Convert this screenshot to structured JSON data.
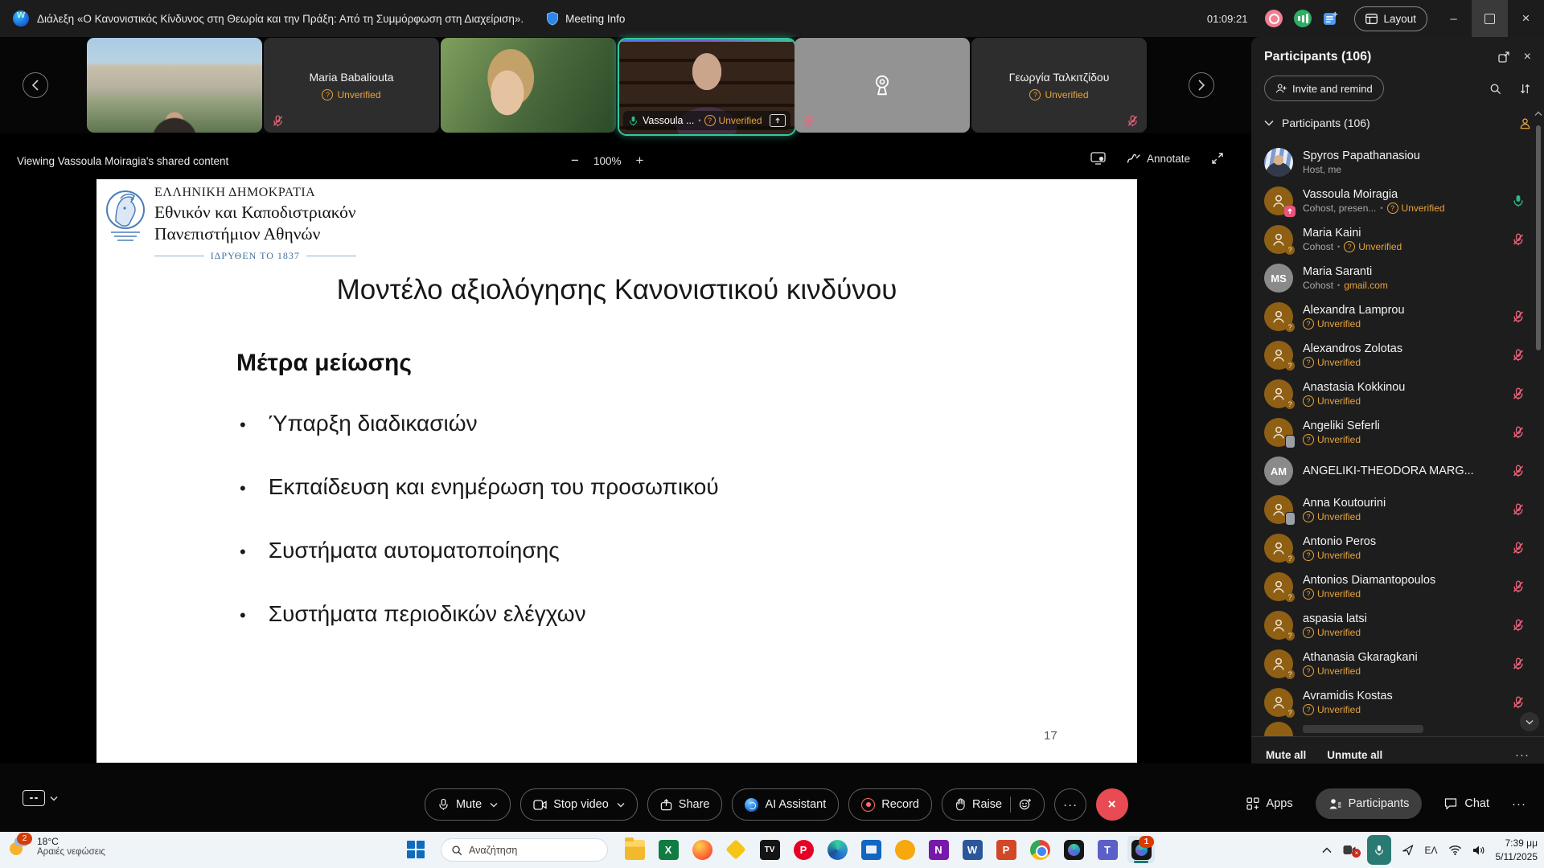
{
  "icons": {
    "more": "···",
    "minimize": "–",
    "close": "×",
    "q": "?",
    "bullet": "•",
    "leave": "×"
  },
  "titlebar": {
    "meeting_title": "Διάλεξη «Ο Κανονιστικός Κίνδυνος στη Θεωρία και την Πράξη: Από τη Συμμόρφωση στη Διαχείριση».",
    "meeting_info": "Meeting Info",
    "timer": "01:09:21",
    "layout_label": "Layout"
  },
  "filmstrip": {
    "tiles": [
      {
        "label": ""
      },
      {
        "name": "Maria Babaliouta",
        "status": "Unverified"
      },
      {
        "label": ""
      },
      {
        "name": "Vassoula ...",
        "status": "Unverified"
      },
      {
        "label": ""
      },
      {
        "name": "Γεωργία  Ταλκιτζίδου",
        "status": "Unverified"
      }
    ]
  },
  "content": {
    "viewing": "Viewing Vassoula Moiragia's shared content",
    "zoom_out": "−",
    "zoom_level": "100%",
    "zoom_in": "+",
    "annotate": "Annotate"
  },
  "slide": {
    "gov": "ΕΛΛΗΝΙΚΗ ΔΗΜΟΚΡΑΤΙΑ",
    "uni1": "Εθνικόν και Καποδιστριακόν",
    "uni2": "Πανεπιστήμιον Αθηνών",
    "founded": "ΙΔΡΥΘΕΝ ΤΟ 1837",
    "title": "Μοντέλο αξιολόγησης Κανονιστικού κινδύνου",
    "subtitle": "Μέτρα μείωσης",
    "bullets": [
      "Ύπαρξη διαδικασιών",
      "Εκπαίδευση και ενημέρωση του προσωπικού",
      "Συστήματα αυτοματοποίησης",
      "Συστήματα περιοδικών ελέγχων"
    ],
    "page": "17"
  },
  "controls": {
    "mute": "Mute",
    "stop_video": "Stop video",
    "share": "Share",
    "ai_assistant": "AI Assistant",
    "record": "Record",
    "raise": "Raise",
    "apps": "Apps",
    "participants": "Participants",
    "chat": "Chat"
  },
  "panel": {
    "title": "Participants (106)",
    "invite": "Invite and remind",
    "section": "Participants (106)",
    "mute_all": "Mute all",
    "unmute_all": "Unmute all",
    "participants": [
      {
        "name": "Spyros Papathanasiou",
        "sub_gray": "Host, me",
        "avatar": "photo",
        "mic": "none"
      },
      {
        "name": "Vassoula Moiragia",
        "sub_gray": "Cohost, presen...",
        "dot": true,
        "sub_orange": "Unverified",
        "q": true,
        "avatar": "share",
        "mic": "on"
      },
      {
        "name": "Maria Kaini",
        "sub_gray": "Cohost",
        "dot": true,
        "sub_orange": "Unverified",
        "q": true,
        "avatar": "question",
        "mic": "muted"
      },
      {
        "name": "Maria Saranti",
        "sub_gray": "Cohost",
        "dot": true,
        "sub_orange": "gmail.com",
        "q": false,
        "avatar": "initials",
        "initials": "MS",
        "mic": "none"
      },
      {
        "name": "Alexandra Lamprou",
        "sub_orange": "Unverified",
        "q": true,
        "avatar": "question",
        "mic": "muted"
      },
      {
        "name": "Alexandros Zolotas",
        "sub_orange": "Unverified",
        "q": true,
        "avatar": "question",
        "mic": "muted"
      },
      {
        "name": "Anastasia Kokkinou",
        "sub_orange": "Unverified",
        "q": true,
        "avatar": "question",
        "mic": "muted"
      },
      {
        "name": "Angeliki Seferli",
        "sub_orange": "Unverified",
        "q": true,
        "avatar": "phone",
        "mic": "muted"
      },
      {
        "name": "ANGELIKI-THEODORA MARG...",
        "avatar": "initials",
        "initials": "AM",
        "mic": "muted"
      },
      {
        "name": "Anna Koutourini",
        "sub_orange": "Unverified",
        "q": true,
        "avatar": "phone",
        "mic": "muted"
      },
      {
        "name": "Antonio Peros",
        "sub_orange": "Unverified",
        "q": true,
        "avatar": "question",
        "mic": "muted"
      },
      {
        "name": "Antonios Diamantopoulos",
        "sub_orange": "Unverified",
        "q": true,
        "avatar": "question",
        "mic": "muted"
      },
      {
        "name": "aspasia latsi",
        "sub_orange": "Unverified",
        "q": true,
        "avatar": "question",
        "mic": "muted"
      },
      {
        "name": "Athanasia Gkaragkani",
        "sub_orange": "Unverified",
        "q": true,
        "avatar": "question",
        "mic": "muted"
      },
      {
        "name": "Avramidis Kostas",
        "sub_orange": "Unverified",
        "q": true,
        "avatar": "question",
        "mic": "muted"
      }
    ]
  },
  "taskbar": {
    "weather_badge": "2",
    "temp": "18°C",
    "weather_desc": "Αραιές νεφώσεις",
    "search_placeholder": "Αναζήτηση",
    "language": "ΕΛ",
    "time": "7:39 μμ",
    "date": "5/11/2025",
    "apps": [
      {
        "key": "explorer",
        "shape": "folder",
        "glyph": ""
      },
      {
        "key": "excel",
        "shape": "square",
        "glyph": "X",
        "bg": "#107c41"
      },
      {
        "key": "firefox",
        "shape": "circle",
        "glyph": ""
      },
      {
        "key": "gem",
        "shape": "diamond",
        "glyph": "",
        "bg": "#f5c515"
      },
      {
        "key": "tv",
        "shape": "square",
        "glyph": "TV",
        "bg": "#141414"
      },
      {
        "key": "pin",
        "shape": "circle",
        "glyph": "P",
        "bg": "#e60023"
      },
      {
        "key": "edge",
        "shape": "circle",
        "glyph": ""
      },
      {
        "key": "cal",
        "shape": "square",
        "glyph": "",
        "bg": "#1266c0"
      },
      {
        "key": "amber",
        "shape": "circle",
        "glyph": "",
        "bg": "#f7a80d"
      },
      {
        "key": "onenote",
        "shape": "square",
        "glyph": "N",
        "bg": "#7719aa"
      },
      {
        "key": "word",
        "shape": "square",
        "glyph": "W",
        "bg": "#2b579a"
      },
      {
        "key": "ppt",
        "shape": "square",
        "glyph": "P",
        "bg": "#d24726"
      },
      {
        "key": "chrome",
        "shape": "circle",
        "glyph": ""
      },
      {
        "key": "webex",
        "shape": "webex",
        "glyph": ""
      },
      {
        "key": "teams",
        "shape": "square",
        "glyph": "T",
        "bg": "#5b5fc7"
      },
      {
        "key": "webex2",
        "shape": "webex",
        "glyph": "",
        "badge": "1",
        "active": true
      }
    ]
  }
}
